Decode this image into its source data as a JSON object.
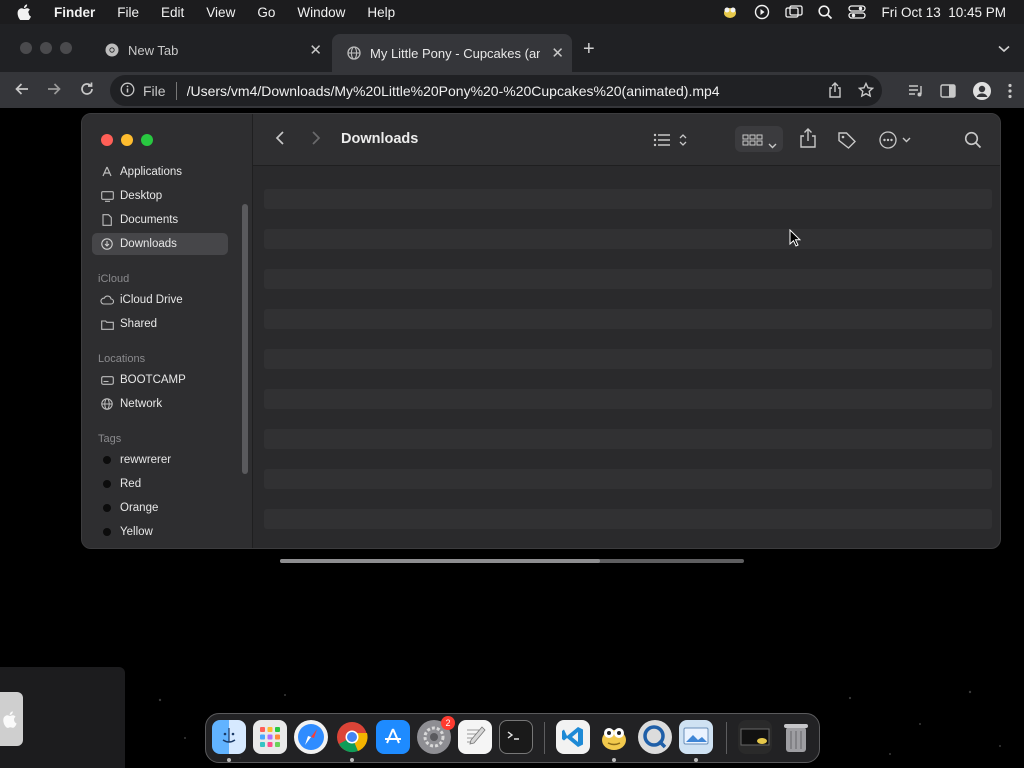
{
  "menubar": {
    "app_name": "Finder",
    "menus": [
      "File",
      "Edit",
      "View",
      "Go",
      "Window",
      "Help"
    ],
    "datetime": "Fri Oct 13  10:45 PM"
  },
  "browser": {
    "tabs": [
      {
        "title": "New Tab",
        "active": false
      },
      {
        "title": "My Little Pony - Cupcakes (an",
        "active": true
      }
    ],
    "scheme_label": "File",
    "url": "/Users/vm4/Downloads/My%20Little%20Pony%20-%20Cupcakes%20(animated).mp4"
  },
  "finder": {
    "title": "Downloads",
    "sidebar": {
      "favorites": [
        {
          "label": "Applications",
          "icon": "applications-icon"
        },
        {
          "label": "Desktop",
          "icon": "desktop-icon"
        },
        {
          "label": "Documents",
          "icon": "document-icon"
        },
        {
          "label": "Downloads",
          "icon": "downloads-icon",
          "selected": true
        }
      ],
      "icloud_header": "iCloud",
      "icloud": [
        {
          "label": "iCloud Drive",
          "icon": "cloud-icon"
        },
        {
          "label": "Shared",
          "icon": "shared-folder-icon"
        }
      ],
      "locations_header": "Locations",
      "locations": [
        {
          "label": "BOOTCAMP",
          "icon": "disk-icon"
        },
        {
          "label": "Network",
          "icon": "network-globe-icon"
        }
      ],
      "tags_header": "Tags",
      "tags": [
        {
          "label": "rewwrerer"
        },
        {
          "label": "Red"
        },
        {
          "label": "Orange"
        },
        {
          "label": "Yellow"
        }
      ]
    }
  },
  "dock": {
    "apps": [
      "finder",
      "launchpad",
      "safari",
      "chrome",
      "app-store",
      "system-settings",
      "textedit",
      "terminal",
      "vscode",
      "cyberduck",
      "quicktime",
      "preview",
      "screenshot-thumbnail",
      "trash"
    ],
    "system_settings_badge": "2"
  },
  "colors": {
    "close": "#ff5f57",
    "minimize": "#febc2e",
    "zoom": "#28c840",
    "selected_sidebar": "#464649"
  }
}
